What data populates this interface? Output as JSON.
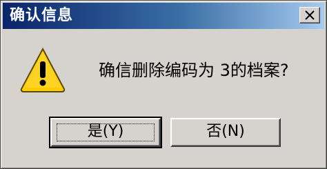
{
  "window": {
    "title": "确认信息"
  },
  "message": {
    "text": "确信删除编码为 3的档案?"
  },
  "buttons": {
    "yes_label": "是(Y)",
    "no_label": "否(N)"
  },
  "icons": {
    "title_close": "close-icon",
    "dialog_icon": "warning-icon"
  },
  "colors": {
    "titlebar_start": "#0a246a",
    "titlebar_end": "#a6caf0",
    "dialog_bg": "#d6d3ce",
    "warning_fill": "#ffcc00"
  }
}
